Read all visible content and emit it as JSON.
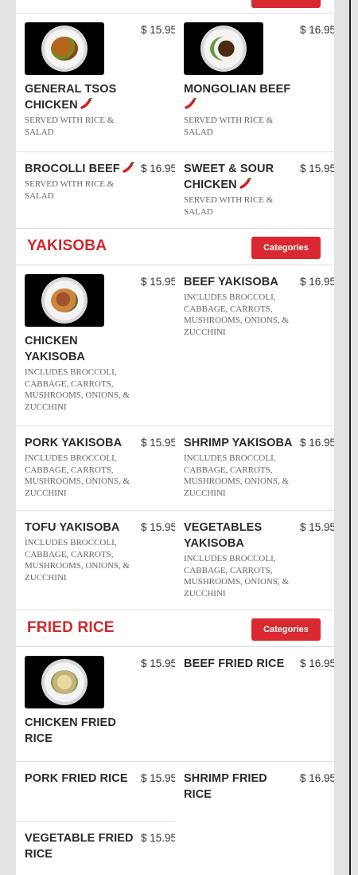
{
  "price_prefix": "$",
  "sections": {
    "chicken_beef": {
      "items": [
        {
          "name": "GENERAL TSOS CHICKEN",
          "price": "$ 15.95",
          "desc": "SERVED WITH RICE & SALAD",
          "spicy": true
        },
        {
          "name": "MONGOLIAN BEEF",
          "price": "$ 16.95",
          "desc": "SERVED WITH RICE & SALAD",
          "spicy": true
        },
        {
          "name": "BROCOLLI BEEF",
          "price": "$ 16.95",
          "desc": "SERVED WITH RICE & SALAD",
          "spicy": true
        },
        {
          "name": "SWEET & SOUR CHICKEN",
          "price": "$ 15.95",
          "desc": "SERVED WITH RICE & SALAD",
          "spicy": true
        }
      ]
    },
    "yakisoba": {
      "title": "YAKISOBA",
      "button": "Categories",
      "items": [
        {
          "name": "CHICKEN YAKISOBA",
          "price": "$ 15.95",
          "desc": "INCLUDES BROCCOLI, CABBAGE, CARROTS, MUSHROOMS, ONIONS, & ZUCCHINI"
        },
        {
          "name": "BEEF YAKISOBA",
          "price": "$ 16.95",
          "desc": "INCLUDES BROCCOLI, CABBAGE, CARROTS, MUSHROOMS, ONIONS, & ZUCCHINI"
        },
        {
          "name": "PORK YAKISOBA",
          "price": "$ 15.95",
          "desc": "INCLUDES BROCCOLI, CABBAGE, CARROTS, MUSHROOMS, ONIONS, & ZUCCHINI"
        },
        {
          "name": "SHRIMP YAKISOBA",
          "price": "$ 16.95",
          "desc": "INCLUDES BROCCOLI, CABBAGE, CARROTS, MUSHROOMS, ONIONS, & ZUCCHINI"
        },
        {
          "name": "TOFU YAKISOBA",
          "price": "$ 15.95",
          "desc": "INCLUDES BROCCOLI, CABBAGE, CARROTS, MUSHROOMS, ONIONS, & ZUCCHINI"
        },
        {
          "name": "VEGETABLES YAKISOBA",
          "price": "$ 15.95",
          "desc": "INCLUDES BROCCOLI, CABBAGE, CARROTS, MUSHROOMS, ONIONS, & ZUCCHINI"
        }
      ]
    },
    "fried_rice": {
      "title": "FRIED RICE",
      "button": "Categories",
      "items": [
        {
          "name": "CHICKEN FRIED RICE",
          "price": "$ 15.95"
        },
        {
          "name": "BEEF FRIED RICE",
          "price": "$ 16.95"
        },
        {
          "name": "PORK FRIED RICE",
          "price": "$ 15.95"
        },
        {
          "name": "SHRIMP FRIED RICE",
          "price": "$ 16.95"
        },
        {
          "name": "VEGETABLE FRIED RICE",
          "price": "$ 15.95"
        }
      ]
    }
  },
  "colors": {
    "accent": "#d9282f",
    "title": "#d1262b"
  },
  "icons": {
    "spicy": "chili-pepper-icon"
  }
}
